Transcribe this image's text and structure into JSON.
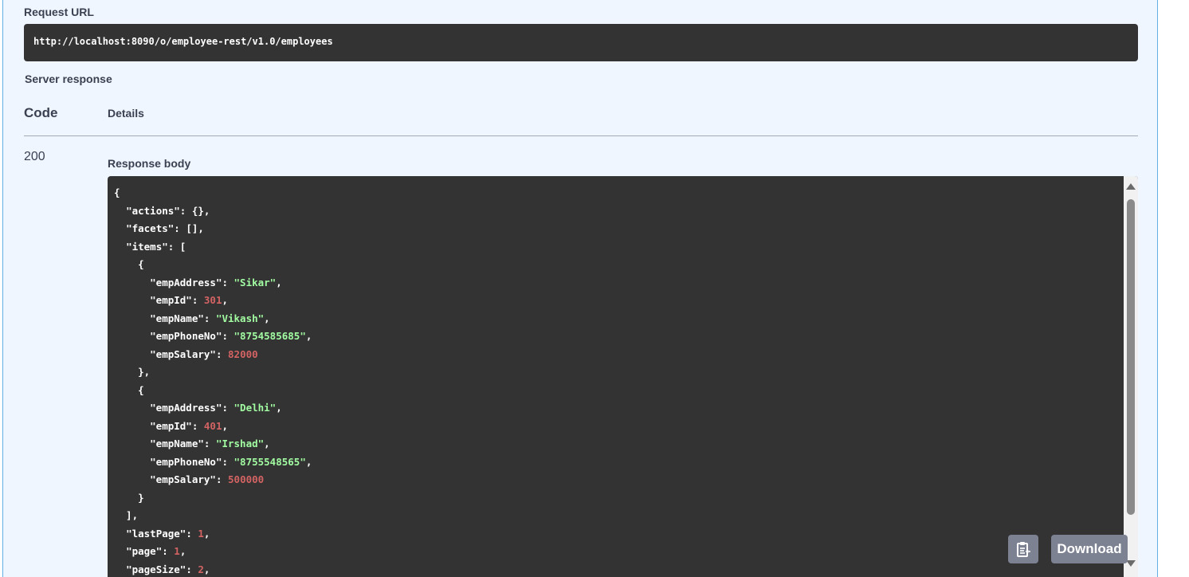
{
  "request_url": {
    "label": "Request URL",
    "value": "http://localhost:8090/o/employee-rest/v1.0/employees"
  },
  "server_response": {
    "label": "Server response",
    "columns": {
      "code": "Code",
      "details": "Details"
    },
    "code": "200",
    "response_body_label": "Response body"
  },
  "response_body_lines": [
    [
      [
        "p",
        "{"
      ]
    ],
    [
      [
        "p",
        "  "
      ],
      [
        "k",
        "\"actions\""
      ],
      [
        "p",
        ": {},"
      ]
    ],
    [
      [
        "p",
        "  "
      ],
      [
        "k",
        "\"facets\""
      ],
      [
        "p",
        ": [],"
      ]
    ],
    [
      [
        "p",
        "  "
      ],
      [
        "k",
        "\"items\""
      ],
      [
        "p",
        ": ["
      ]
    ],
    [
      [
        "p",
        "    {"
      ]
    ],
    [
      [
        "p",
        "      "
      ],
      [
        "k",
        "\"empAddress\""
      ],
      [
        "p",
        ": "
      ],
      [
        "s",
        "\"Sikar\""
      ],
      [
        "p",
        ","
      ]
    ],
    [
      [
        "p",
        "      "
      ],
      [
        "k",
        "\"empId\""
      ],
      [
        "p",
        ": "
      ],
      [
        "n",
        "301"
      ],
      [
        "p",
        ","
      ]
    ],
    [
      [
        "p",
        "      "
      ],
      [
        "k",
        "\"empName\""
      ],
      [
        "p",
        ": "
      ],
      [
        "s",
        "\"Vikash\""
      ],
      [
        "p",
        ","
      ]
    ],
    [
      [
        "p",
        "      "
      ],
      [
        "k",
        "\"empPhoneNo\""
      ],
      [
        "p",
        ": "
      ],
      [
        "s",
        "\"8754585685\""
      ],
      [
        "p",
        ","
      ]
    ],
    [
      [
        "p",
        "      "
      ],
      [
        "k",
        "\"empSalary\""
      ],
      [
        "p",
        ": "
      ],
      [
        "n",
        "82000"
      ]
    ],
    [
      [
        "p",
        "    },"
      ]
    ],
    [
      [
        "p",
        "    {"
      ]
    ],
    [
      [
        "p",
        "      "
      ],
      [
        "k",
        "\"empAddress\""
      ],
      [
        "p",
        ": "
      ],
      [
        "s",
        "\"Delhi\""
      ],
      [
        "p",
        ","
      ]
    ],
    [
      [
        "p",
        "      "
      ],
      [
        "k",
        "\"empId\""
      ],
      [
        "p",
        ": "
      ],
      [
        "n",
        "401"
      ],
      [
        "p",
        ","
      ]
    ],
    [
      [
        "p",
        "      "
      ],
      [
        "k",
        "\"empName\""
      ],
      [
        "p",
        ": "
      ],
      [
        "s",
        "\"Irshad\""
      ],
      [
        "p",
        ","
      ]
    ],
    [
      [
        "p",
        "      "
      ],
      [
        "k",
        "\"empPhoneNo\""
      ],
      [
        "p",
        ": "
      ],
      [
        "s",
        "\"8755548565\""
      ],
      [
        "p",
        ","
      ]
    ],
    [
      [
        "p",
        "      "
      ],
      [
        "k",
        "\"empSalary\""
      ],
      [
        "p",
        ": "
      ],
      [
        "n",
        "500000"
      ]
    ],
    [
      [
        "p",
        "    }"
      ]
    ],
    [
      [
        "p",
        "  ],"
      ]
    ],
    [
      [
        "p",
        "  "
      ],
      [
        "k",
        "\"lastPage\""
      ],
      [
        "p",
        ": "
      ],
      [
        "n",
        "1"
      ],
      [
        "p",
        ","
      ]
    ],
    [
      [
        "p",
        "  "
      ],
      [
        "k",
        "\"page\""
      ],
      [
        "p",
        ": "
      ],
      [
        "n",
        "1"
      ],
      [
        "p",
        ","
      ]
    ],
    [
      [
        "p",
        "  "
      ],
      [
        "k",
        "\"pageSize\""
      ],
      [
        "p",
        ": "
      ],
      [
        "n",
        "2"
      ],
      [
        "p",
        ","
      ]
    ]
  ],
  "buttons": {
    "copy_icon": "clipboard-icon",
    "download_label": "Download"
  },
  "colors": {
    "panel_bg": "#eff6ff",
    "code_bg": "#333333",
    "string": "#a2fca2",
    "number": "#d36363",
    "button_bg": "#7d8293"
  }
}
